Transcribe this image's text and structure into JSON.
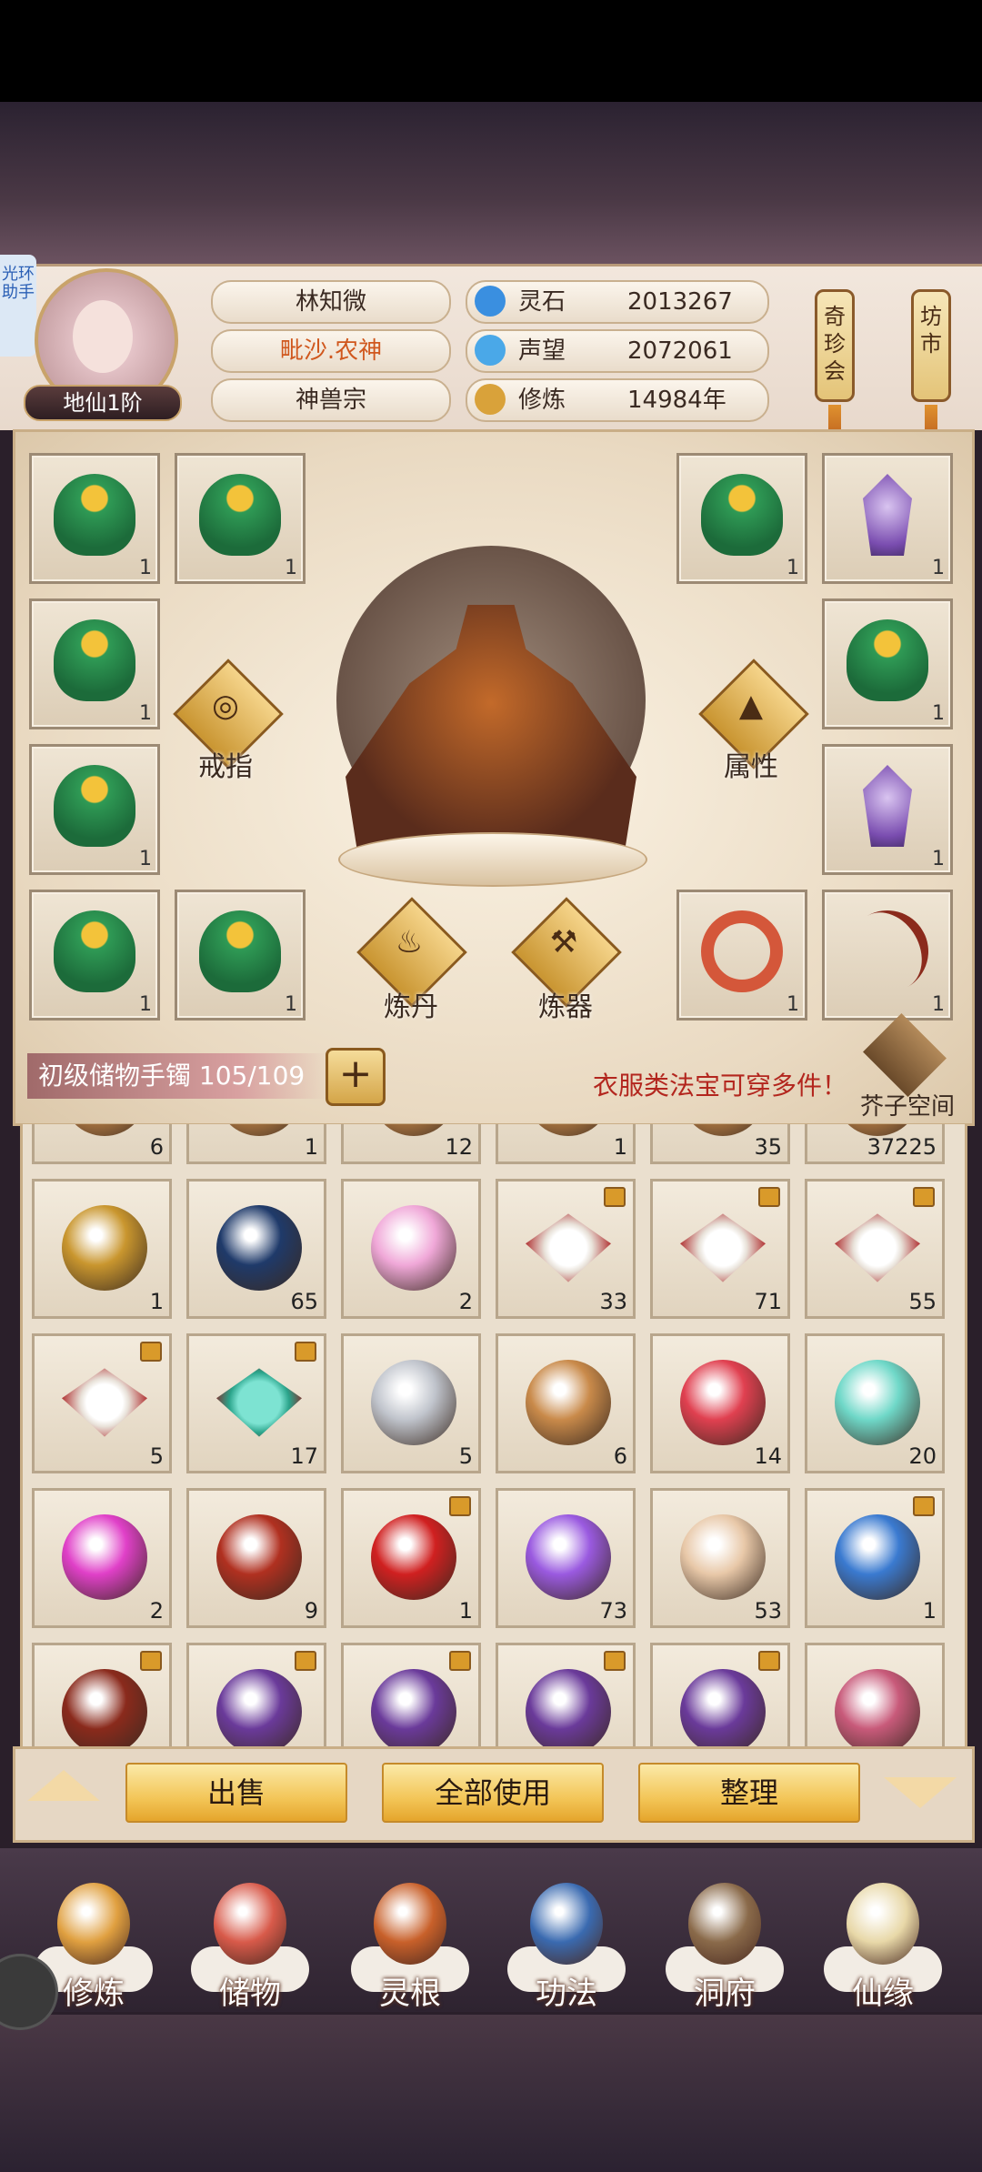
{
  "helper": {
    "label": "光环助手"
  },
  "player": {
    "name": "林知微",
    "title": "毗沙.农神",
    "sect": "神兽宗",
    "rank": "地仙1阶"
  },
  "resources": [
    {
      "label": "灵石",
      "value": "2013267",
      "color": "#3a8fe0"
    },
    {
      "label": "声望",
      "value": "2072061",
      "color": "#4aa8e8"
    },
    {
      "label": "修炼",
      "value": "14984年",
      "color": "#d9a23a"
    }
  ],
  "side_buttons": {
    "treasure_fair": "奇珍会",
    "market": "坊市"
  },
  "equipment": {
    "ring_label": "戒指",
    "attr_label": "属性",
    "alchemy_label": "炼丹",
    "forge_label": "炼器",
    "ring_icon": "ring-icon",
    "attr_icon": "hat-icon",
    "slots": [
      {
        "art": "leaf",
        "count": "1"
      },
      {
        "art": "leaf",
        "count": "1"
      },
      {
        "art": "leaf",
        "count": "1"
      },
      {
        "art": "crystal",
        "count": "1"
      },
      {
        "art": "leaf",
        "count": "1"
      },
      {
        "art": "leaf",
        "count": "1"
      },
      {
        "art": "leaf",
        "count": "1"
      },
      {
        "art": "crystal",
        "count": "1"
      },
      {
        "art": "leaf",
        "count": "1"
      },
      {
        "art": "leaf",
        "count": "1"
      },
      {
        "art": "snake-ring",
        "count": "1"
      },
      {
        "art": "bow",
        "count": "1"
      }
    ]
  },
  "storage": {
    "name": "初级储物手镯 105/109",
    "plus": "+",
    "wear_tip": "衣服类法宝可穿多件！",
    "mustard_space": "芥子空间"
  },
  "inventory_rows": [
    [
      {
        "count": "6"
      },
      {
        "count": "1"
      },
      {
        "count": "12"
      },
      {
        "count": "1"
      },
      {
        "count": "35"
      },
      {
        "count": "37225"
      }
    ],
    [
      {
        "count": "1",
        "color": "#c9962e"
      },
      {
        "count": "65",
        "color": "#1f3a6a"
      },
      {
        "count": "2",
        "color": "#f0a8d8"
      },
      {
        "count": "33",
        "art": "rice",
        "lock": true
      },
      {
        "count": "71",
        "art": "rice",
        "lock": true
      },
      {
        "count": "55",
        "art": "rice",
        "lock": true
      }
    ],
    [
      {
        "count": "5",
        "art": "rice",
        "lock": true
      },
      {
        "count": "17",
        "art": "teal",
        "lock": true
      },
      {
        "count": "5",
        "color": "#c0c4cc"
      },
      {
        "count": "6",
        "color": "#c98a4a"
      },
      {
        "count": "14",
        "color": "#e04050"
      },
      {
        "count": "20",
        "color": "#6fd8c8"
      }
    ],
    [
      {
        "count": "2",
        "color": "#e040c8"
      },
      {
        "count": "9",
        "color": "#b03020"
      },
      {
        "count": "1",
        "color": "#d02020",
        "lock": true
      },
      {
        "count": "73",
        "color": "#9a5ae0"
      },
      {
        "count": "53",
        "color": "#e8c8a8"
      },
      {
        "count": "1",
        "color": "#3a7ad0",
        "lock": true
      }
    ],
    [
      {
        "count": "",
        "color": "#8a2a1c",
        "lock": true
      },
      {
        "count": "",
        "color": "#6a3a9a",
        "lock": true
      },
      {
        "count": "",
        "color": "#6a3a9a",
        "lock": true
      },
      {
        "count": "",
        "color": "#6a3a9a",
        "lock": true
      },
      {
        "count": "",
        "color": "#6a3a9a",
        "lock": true
      },
      {
        "count": "",
        "color": "#c85a7a"
      }
    ]
  ],
  "actions": {
    "sell": "出售",
    "use_all": "全部使用",
    "sort": "整理"
  },
  "nav": [
    {
      "label": "修炼",
      "color": "#e0a040"
    },
    {
      "label": "储物",
      "color": "#d85a4a"
    },
    {
      "label": "灵根",
      "color": "#c8602a"
    },
    {
      "label": "功法",
      "color": "#3a6ab0"
    },
    {
      "label": "洞府",
      "color": "#8a6a4a"
    },
    {
      "label": "仙缘",
      "color": "#e8d8a8"
    }
  ]
}
